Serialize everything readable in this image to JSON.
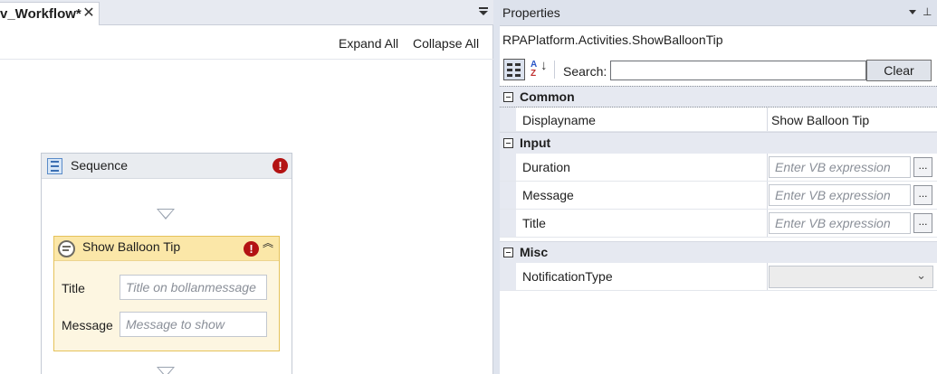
{
  "designer": {
    "tab_title": "v_Workflow*",
    "tab_close": "✕",
    "toolbar": {
      "expand_all": "Expand All",
      "collapse_all": "Collapse All"
    },
    "sequence": {
      "title": "Sequence",
      "error_glyph": "!",
      "activity": {
        "title": "Show Balloon Tip",
        "error_glyph": "!",
        "collapse_glyph": "︽",
        "fields": [
          {
            "label": "Title",
            "placeholder": "Title on bollanmessage"
          },
          {
            "label": "Message",
            "placeholder": "Message to show"
          }
        ]
      }
    }
  },
  "properties": {
    "panel_title": "Properties",
    "activity_type": "RPAPlatform.Activities.ShowBalloonTip",
    "search": {
      "label": "Search:",
      "value": "",
      "clear_label": "Clear"
    },
    "categories": [
      {
        "name": "Common",
        "rows": [
          {
            "name": "Displayname",
            "value": "Show Balloon Tip"
          }
        ]
      },
      {
        "name": "Input",
        "rows": [
          {
            "name": "Duration",
            "placeholder": "Enter  VB expression",
            "button": "..."
          },
          {
            "name": "Message",
            "placeholder": "Enter  VB expression",
            "button": "..."
          },
          {
            "name": "Title",
            "placeholder": "Enter  VB expression",
            "button": "..."
          }
        ]
      },
      {
        "name": "Misc",
        "rows": [
          {
            "name": "NotificationType",
            "value": ""
          }
        ]
      }
    ]
  },
  "icons": {
    "sequence": "sequence-icon",
    "activity": "balloon-tip-icon",
    "error": "error-icon",
    "collapse": "collapse-chevrons-icon",
    "categorized": "categorized-view-icon",
    "alphabetical": "sort-alphabetical-icon",
    "pin": "pin-icon",
    "dropdown": "chevron-down-icon"
  },
  "colors": {
    "error": "#b31313",
    "activity_header": "#fbe7a8",
    "activity_border": "#e5c25a",
    "category_row": "#e6e9f1"
  }
}
